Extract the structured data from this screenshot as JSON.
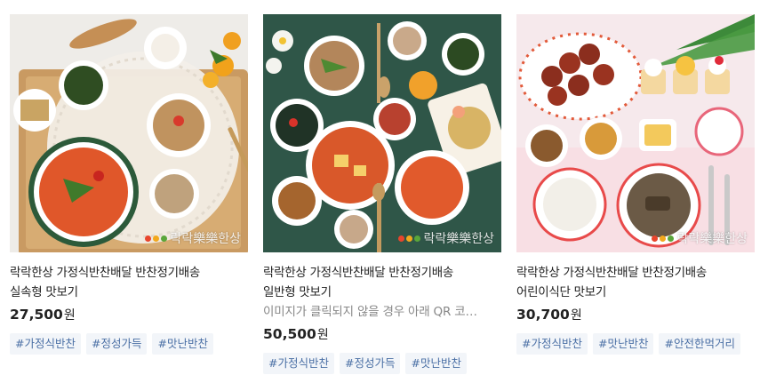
{
  "products": [
    {
      "title_line1": "락락한상 가정식반찬배달 반찬정기배송",
      "title_line2": "실속형 맛보기",
      "description": "",
      "price": "27,500",
      "currency": "원",
      "tags": [
        "#가정식반찬",
        "#정성가득",
        "#맛난반찬"
      ],
      "watermark": "락락樂樂한상"
    },
    {
      "title_line1": "락락한상 가정식반찬배달 반찬정기배송",
      "title_line2": "일반형 맛보기",
      "description": "이미지가 클릭되지 않을 경우 아래 QR 코드...",
      "price": "50,500",
      "currency": "원",
      "tags": [
        "#가정식반찬",
        "#정성가득",
        "#맛난반찬"
      ],
      "watermark": "락락樂樂한상"
    },
    {
      "title_line1": "락락한상 가정식반찬배달 반찬정기배송",
      "title_line2": "어린이식단 맛보기",
      "description": "",
      "price": "30,700",
      "currency": "원",
      "tags": [
        "#가정식반찬",
        "#맛난반찬",
        "#안전한먹거리"
      ],
      "watermark": "락락樂樂한상"
    }
  ],
  "colors": {
    "tag_text": "#4a6fa5",
    "tag_bg": "#f2f5f9",
    "watermark_dot_1": "#e8452c",
    "watermark_dot_2": "#f2a81d",
    "watermark_dot_3": "#5aa63a"
  }
}
